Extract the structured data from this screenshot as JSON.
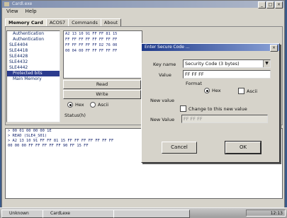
{
  "window": {
    "title": "Cardl.exe",
    "min": "_",
    "max": "□",
    "close": "×"
  },
  "menu": [
    "View",
    "Help"
  ],
  "tabs": [
    "Memory Card",
    "ACOS7",
    "Commands",
    "About"
  ],
  "tree": [
    {
      "label": "Authentication",
      "sub": true
    },
    {
      "label": "Authentication",
      "sub": true
    },
    {
      "label": "SLE4404",
      "sub": false
    },
    {
      "label": "SLE4418",
      "sub": false
    },
    {
      "label": "SLE4428",
      "sub": false
    },
    {
      "label": "SLE4432",
      "sub": false
    },
    {
      "label": "SLE4442",
      "sub": false
    },
    {
      "label": "Protected bits",
      "sub": true,
      "selected": true
    },
    {
      "label": "Main Memory",
      "sub": true
    }
  ],
  "hex_rows": [
    "A2 13 10 91 FF FF 81 15",
    "FF FF FF FF FF FF FF FF",
    "FF FF FF FF FF D2 76 00",
    "00 04 00 FF FF FF FF FF"
  ],
  "buttons": {
    "read": "Read",
    "write": "Write"
  },
  "radios": {
    "hex": "Hex",
    "ascii": "Ascii"
  },
  "status_label": "Status(h)",
  "log_lines": [
    "> 00 01 00 00 00 1E",
    "> READ (SLE4_S01)",
    "> A2 13 10 91 FF FF 81 15 FF FF FF FF FF FF FF",
    "00 00 00 FF FF FF FF FF 90 FF 15 FF"
  ],
  "dialog": {
    "title": "Enter Secure Code ...",
    "key_name_label": "Key name",
    "key_name_value": "Security Code (3 bytes)",
    "value_label": "Value",
    "value_value": "FF FF FF",
    "format_label": "Format",
    "format_hex": "Hex",
    "format_ascii": "Ascii",
    "new_value_label": "New value",
    "change_label": "Change to this new value",
    "new_value_field_label": "New Value",
    "new_value_value": "FF FF FF",
    "cancel": "Cancel",
    "ok": "OK"
  },
  "taskbar": {
    "items": [
      "Unknown",
      "CardLexe",
      ""
    ],
    "tray": "12:13"
  }
}
